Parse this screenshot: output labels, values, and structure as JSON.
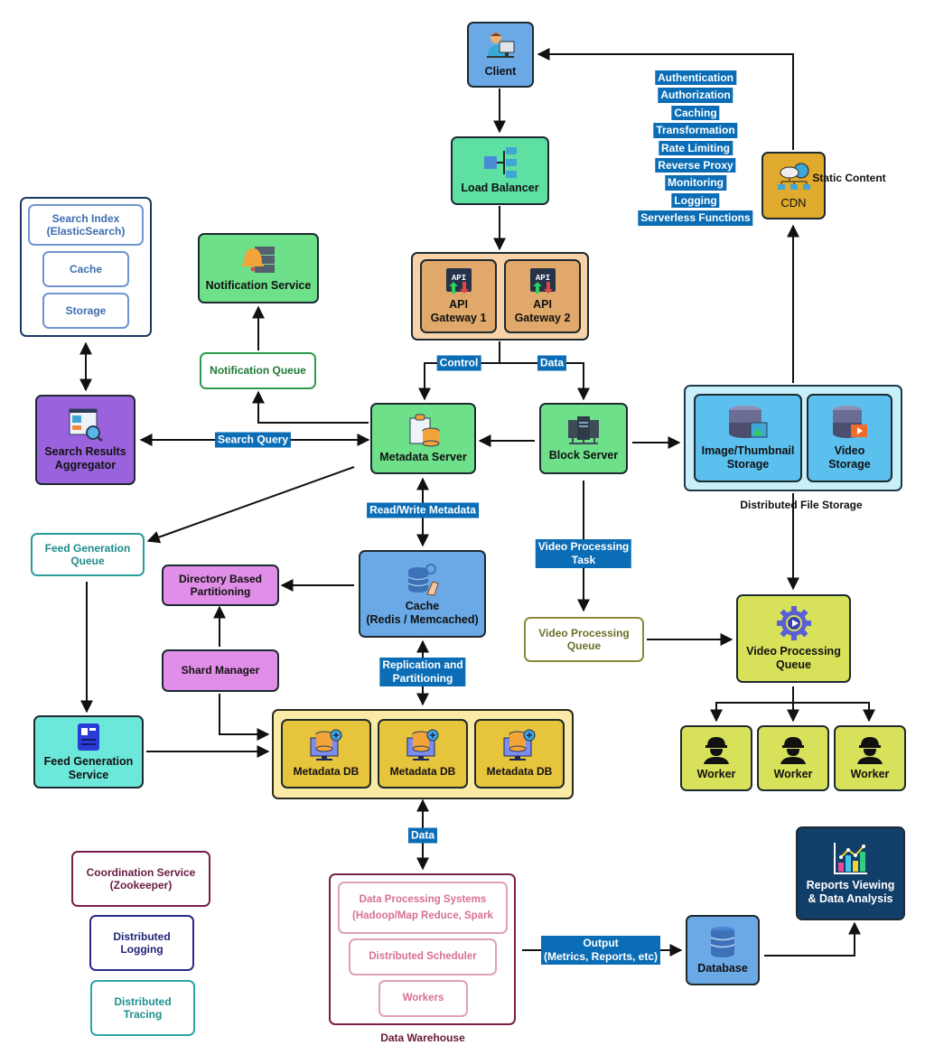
{
  "diagram": {
    "client": {
      "label": "Client"
    },
    "load_balancer": {
      "label": "Load Balancer"
    },
    "api_gateways": [
      {
        "label": "API\nGateway 1",
        "icon_text": "API"
      },
      {
        "label": "API\nGateway 2",
        "icon_text": "API"
      }
    ],
    "gateway_features": [
      "Authentication",
      "Authorization",
      "Caching",
      "Transformation",
      "Rate Limiting",
      "Reverse Proxy",
      "Monitoring",
      "Logging",
      "Serverless Functions"
    ],
    "cdn": {
      "label": "CDN",
      "caption": "Static\nContent"
    },
    "search_cluster": {
      "items": [
        "Search Index\n(ElasticSearch)",
        "Cache",
        "Storage"
      ]
    },
    "notification_service": {
      "label": "Notification Service"
    },
    "notification_queue": {
      "label": "Notification Queue"
    },
    "search_results_aggregator": {
      "label": "Search Results\nAggregator"
    },
    "metadata_server": {
      "label": "Metadata Server"
    },
    "block_server": {
      "label": "Block Server"
    },
    "distributed_file_storage": {
      "caption": "Distributed File Storage",
      "items": [
        {
          "label": "Image/Thumbnail\nStorage"
        },
        {
          "label": "Video\nStorage"
        }
      ]
    },
    "feed_generation_queue": {
      "label": "Feed Generation\nQueue"
    },
    "directory_based_partitioning": {
      "label": "Directory Based\nPartitioning"
    },
    "cache": {
      "label": "Cache\n(Redis / Memcached)"
    },
    "shard_manager": {
      "label": "Shard Manager"
    },
    "video_processing_queue_outline": {
      "label": "Video Processing\nQueue"
    },
    "video_processing_queue": {
      "label": "Video Processing\nQueue"
    },
    "workers": [
      {
        "label": "Worker"
      },
      {
        "label": "Worker"
      },
      {
        "label": "Worker"
      }
    ],
    "feed_generation_service": {
      "label": "Feed Generation\nService"
    },
    "metadata_dbs": [
      {
        "label": "Metadata DB"
      },
      {
        "label": "Metadata DB"
      },
      {
        "label": "Metadata DB"
      }
    ],
    "coordination_service": {
      "label": "Coordination Service\n(Zookeeper)"
    },
    "distributed_logging": {
      "label": "Distributed\nLogging"
    },
    "distributed_tracing": {
      "label": "Distributed\nTracing"
    },
    "data_warehouse": {
      "caption": "Data Warehouse",
      "items": [
        "Data Processing Systems\n(Hadoop/Map Reduce, Spark",
        "Distributed Scheduler",
        "Workers"
      ]
    },
    "database": {
      "label": "Database"
    },
    "reports": {
      "label": "Reports Viewing\n& Data Analysis"
    },
    "edge_labels": {
      "control": "Control",
      "data_gateway": "Data",
      "search_query": "Search Query",
      "read_write_metadata": "Read/Write Metadata",
      "video_processing_task": "Video Processing\nTask",
      "replication_partitioning": "Replication and\nPartitioning",
      "data_warehouse_link": "Data",
      "output": "Output\n(Metrics, Reports, etc)"
    }
  },
  "colors": {
    "client": "#6aa9e6",
    "load_balancer": "#5ee0a3",
    "gateway_outer": "#f8d2a8",
    "gateway_inner": "#e0a86a",
    "green_service": "#6ee08a",
    "purple": "#9a63dd",
    "orchid": "#e08ee8",
    "cache_blue": "#6aa9e6",
    "file_storage_outer": "#c9effb",
    "file_storage_inner": "#5cc0ef",
    "lime": "#d7e25a",
    "cdn": "#e0aa2e",
    "db_outer": "#fbeaa6",
    "db_inner": "#e6c43c",
    "teal": "#6ce8da",
    "navy": "#123e6a",
    "tag_blue": "#0b6db5"
  }
}
